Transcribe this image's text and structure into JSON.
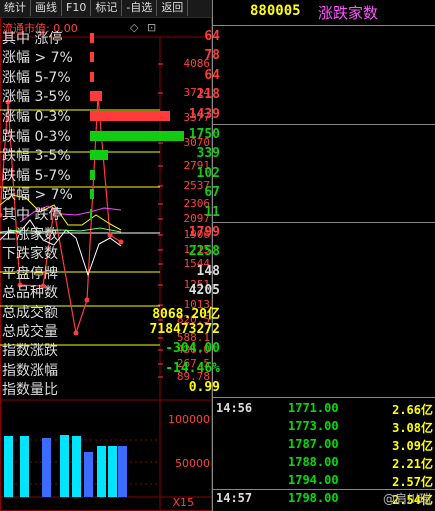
{
  "toolbar": {
    "buttons": [
      "统计",
      "画线",
      "F10",
      "标记",
      "-自选",
      "返回"
    ]
  },
  "header": {
    "code": "880005",
    "name": "涨跌家数"
  },
  "chart": {
    "flow_label": "流通市值: 0.00",
    "diamond_glyph": "◇",
    "settings_glyph": "⊡",
    "price_axis": [
      "4086",
      "3714",
      "3377",
      "3070",
      "2791",
      "2537",
      "2306",
      "2097",
      "1906",
      "1715",
      "1544",
      "1251",
      "1013",
      "820.5",
      "588.1",
      "436.0",
      "267.5",
      "89.78"
    ],
    "volume_axis": [
      "100000",
      "50000"
    ],
    "volume_unit": "X15",
    "colors": {
      "red": "#ff3b3b",
      "white": "#ffffff",
      "yellow": "#ffff00",
      "magenta": "#ff44ff",
      "green": "#66ff66",
      "cyan": "#00e5ff",
      "blue": "#3b6bff"
    }
  },
  "up_stats": [
    {
      "label": "其中 涨停",
      "value": "64"
    },
    {
      "label": "涨幅 > 7%",
      "value": "78"
    },
    {
      "label": "涨幅 5-7%",
      "value": "64"
    },
    {
      "label": "涨幅 3-5%",
      "value": "218"
    },
    {
      "label": "涨幅 0-3%",
      "value": "1439"
    }
  ],
  "down_stats": [
    {
      "label": "跌幅 0-3%",
      "value": "1750"
    },
    {
      "label": "跌幅 3-5%",
      "value": "339"
    },
    {
      "label": "跌幅 5-7%",
      "value": "102"
    },
    {
      "label": "跌幅 > 7%",
      "value": "67"
    },
    {
      "label": "其中 跌停",
      "value": "11"
    }
  ],
  "summary": [
    {
      "label": "上涨家数",
      "value": "1799",
      "color": "#ff3b3b"
    },
    {
      "label": "下跌家数",
      "value": "2258",
      "color": "#00dd00"
    },
    {
      "label": "平盘停牌",
      "value": "148",
      "color": "#dddddd"
    },
    {
      "label": "总品种数",
      "value": "4205",
      "color": "#dddddd"
    },
    {
      "label": "总成交额",
      "value": "8068.20亿",
      "color": "#ffff00"
    },
    {
      "label": "总成交量",
      "value": "718473272",
      "color": "#ffff00"
    },
    {
      "label": "指数涨跌",
      "value": "-304.00",
      "color": "#00dd00"
    },
    {
      "label": "指数涨幅",
      "value": "-14.46%",
      "color": "#00dd00"
    },
    {
      "label": "指数量比",
      "value": "0.99",
      "color": "#ffff00"
    }
  ],
  "ticks": [
    {
      "time": "14:56",
      "price": "1771.00",
      "amount": "2.66亿"
    },
    {
      "time": "",
      "price": "1773.00",
      "amount": "3.08亿"
    },
    {
      "time": "",
      "price": "1787.00",
      "amount": "3.09亿"
    },
    {
      "time": "",
      "price": "1788.00",
      "amount": "2.21亿"
    },
    {
      "time": "",
      "price": "1794.00",
      "amount": "2.57亿"
    },
    {
      "time": "14:57",
      "price": "1798.00",
      "amount": "2.54亿"
    }
  ],
  "watermark": "@肩川瑞"
}
